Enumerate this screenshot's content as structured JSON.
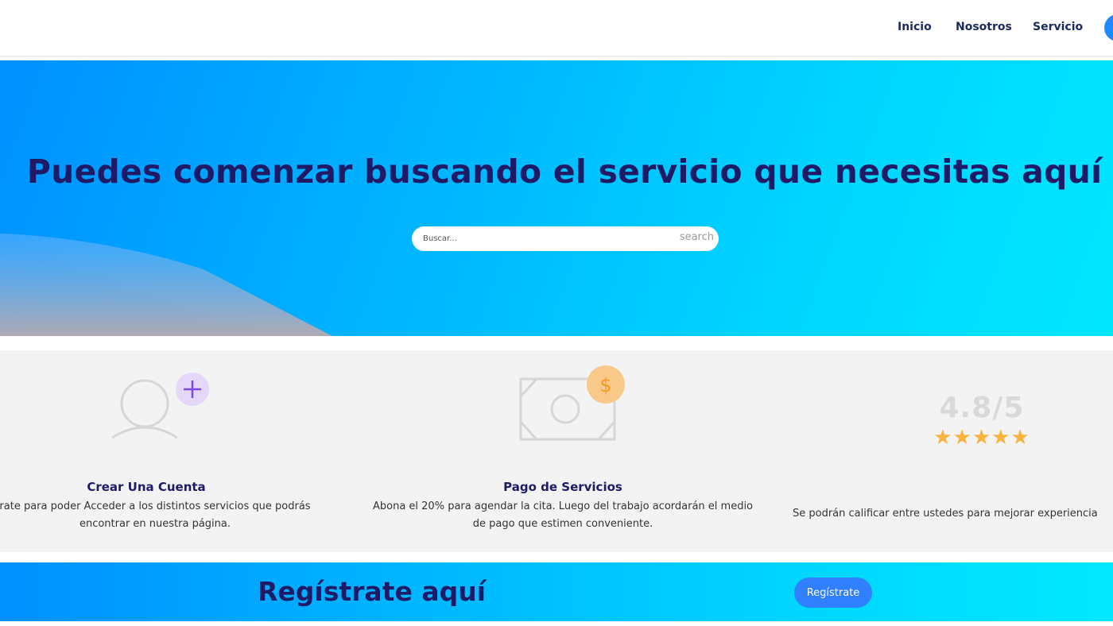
{
  "nav": {
    "items": [
      {
        "label": "Inicio"
      },
      {
        "label": "Nosotros"
      },
      {
        "label": "Servicio"
      }
    ]
  },
  "hero": {
    "title": "Puedes comenzar buscando el servicio que necesitas aquí",
    "search": {
      "placeholder": "Buscar...",
      "button_label": "search"
    }
  },
  "features": [
    {
      "icon": "user-add-icon",
      "title": "Crear Una Cuenta",
      "desc_line1": "rate para poder Acceder a los distintos servicios que podrás",
      "desc_line2": "encontrar en nuestra página."
    },
    {
      "icon": "money-dollar-icon",
      "title": "Pago de Servicios",
      "desc_line1": "Abona el 20% para agendar la cita. Luego del trabajo acordarán el medio",
      "desc_line2": "de pago que estimen conveniente."
    },
    {
      "icon": "rating-stars",
      "rating_value": "4.8/5",
      "stars": "★★★★★",
      "desc_line1": "Se podrán calificar entre ustedes para mejorar experiencia"
    }
  ],
  "cta": {
    "title": "Regístrate aquí",
    "button_label": "Regístrate"
  },
  "colors": {
    "brand_blue": "#0090ff",
    "brand_cyan": "#00e6ff",
    "heading": "#1f1a66",
    "star": "#f7b33b"
  }
}
